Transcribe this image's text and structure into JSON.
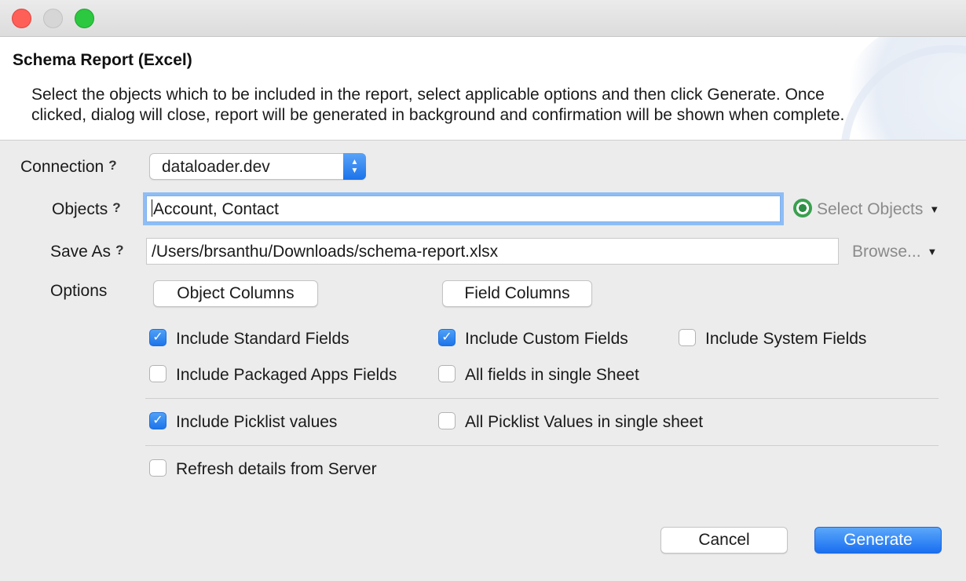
{
  "window": {
    "title": "Schema Report (Excel)",
    "description": "Select the objects which to be included in the report, select applicable options and then click Generate. Once clicked, dialog will close, report will be generated in background and confirmation will be shown when complete."
  },
  "connection": {
    "label": "Connection",
    "help": "?",
    "value": "dataloader.dev"
  },
  "objects": {
    "label": "Objects",
    "help": "?",
    "value": "Account, Contact",
    "select_label": "Select Objects"
  },
  "save_as": {
    "label": "Save As",
    "help": "?",
    "value": "/Users/brsanthu/Downloads/schema-report.xlsx",
    "browse_label": "Browse..."
  },
  "options": {
    "label": "Options",
    "object_columns_label": "Object Columns",
    "field_columns_label": "Field Columns"
  },
  "checkboxes": {
    "standard_fields": {
      "label": "Include Standard Fields",
      "checked": true
    },
    "custom_fields": {
      "label": "Include Custom Fields",
      "checked": true
    },
    "system_fields": {
      "label": "Include System Fields",
      "checked": false
    },
    "packaged_fields": {
      "label": "Include Packaged Apps Fields",
      "checked": false
    },
    "single_sheet_fields": {
      "label": "All fields in single Sheet",
      "checked": false
    },
    "picklist_values": {
      "label": "Include Picklist values",
      "checked": true
    },
    "single_sheet_picklist": {
      "label": "All Picklist Values in single sheet",
      "checked": false
    },
    "refresh_server": {
      "label": "Refresh details from Server",
      "checked": false
    }
  },
  "footer": {
    "cancel_label": "Cancel",
    "generate_label": "Generate"
  },
  "colors": {
    "accent": "#1d74ea",
    "focus_ring": "#8ebdf6"
  }
}
